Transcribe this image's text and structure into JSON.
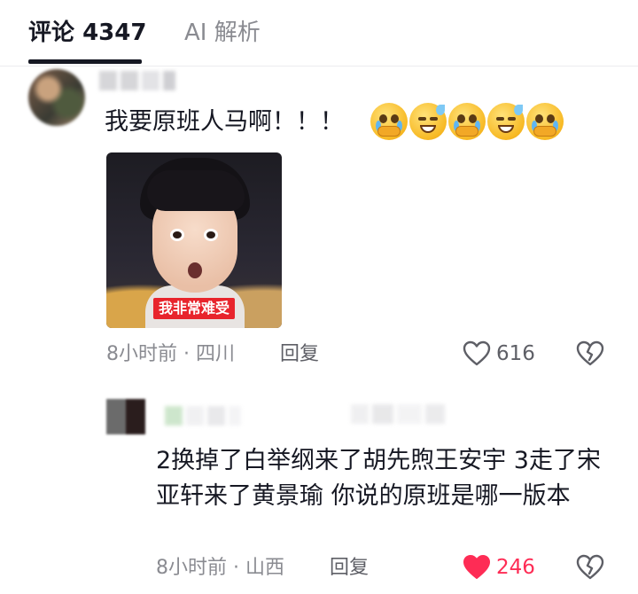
{
  "tabs": {
    "comments_label": "评论",
    "comments_count": "4347",
    "ai_label": "AI 解析"
  },
  "comments": [
    {
      "text": "我要原班人马啊！！！",
      "emoji_names": [
        "crying-face-icon",
        "grinning-sweat-icon",
        "crying-face-icon",
        "grinning-sweat-icon",
        "crying-face-icon"
      ],
      "image_caption": "我非常难受",
      "time": "8小时前",
      "location": "四川",
      "reply_label": "回复",
      "likes": "616",
      "liked": false
    },
    {
      "text": "2换掉了白举纲来了胡先煦王安宇 3走了宋亚轩来了黄景瑜 你说的原班是哪一版本",
      "time": "8小时前",
      "location": "山西",
      "reply_label": "回复",
      "likes": "246",
      "liked": true
    }
  ],
  "colors": {
    "text_primary": "#161823",
    "text_secondary": "#8a8b91",
    "liked_red": "#fe2c55",
    "caption_red": "#e8242c"
  }
}
